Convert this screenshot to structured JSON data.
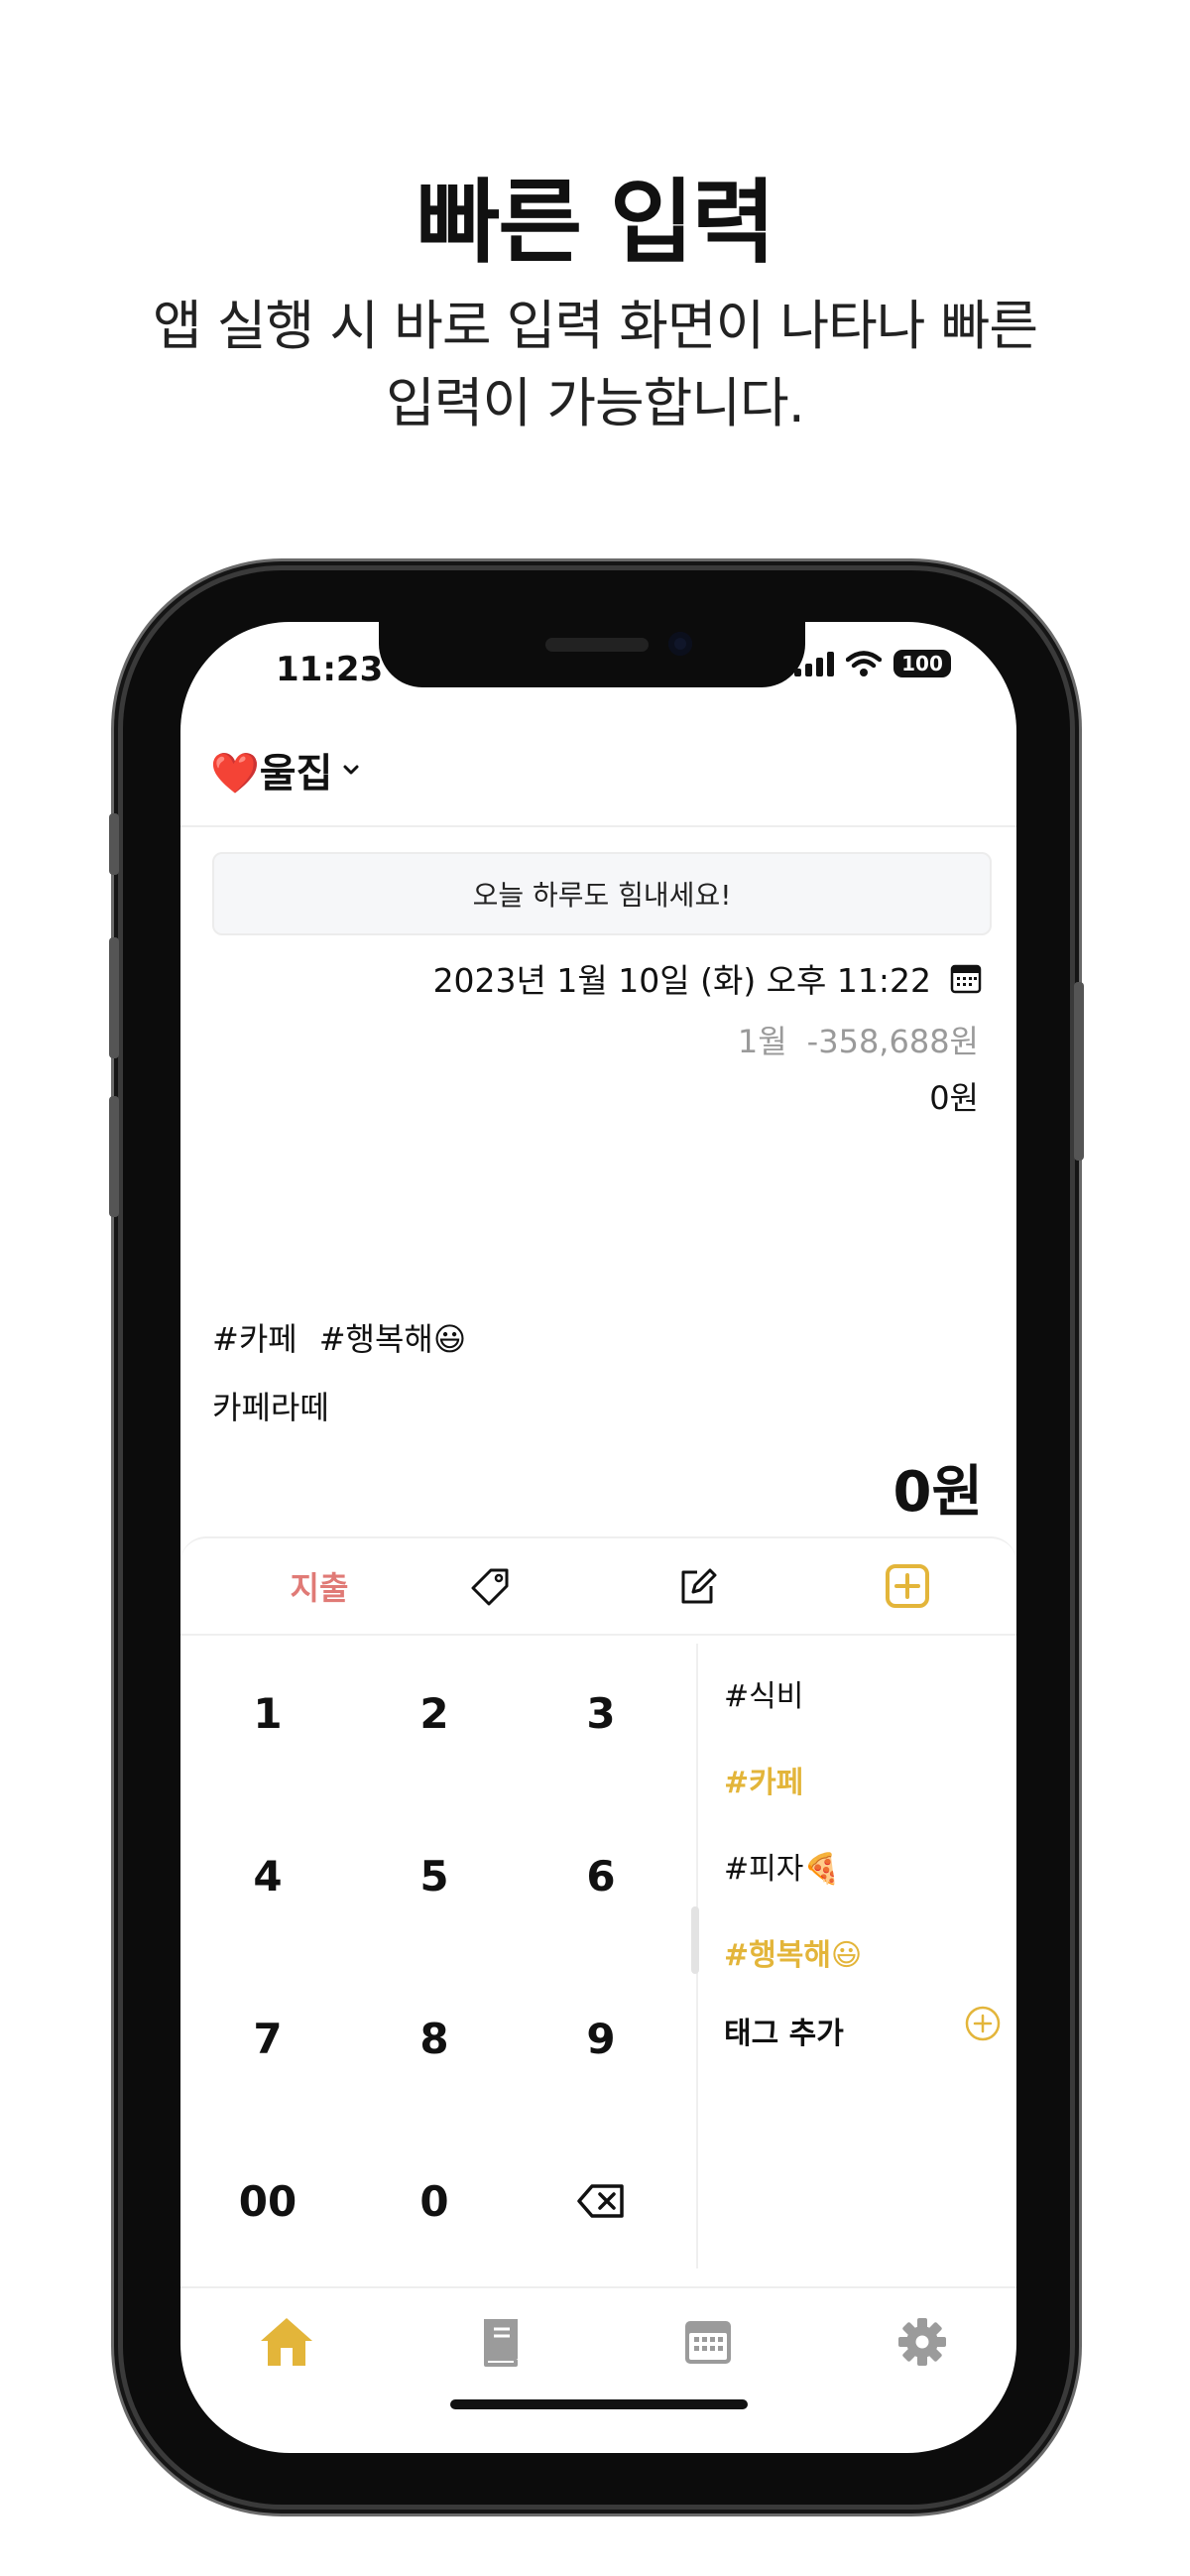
{
  "promo": {
    "title": "빠른 입력",
    "subtitle": "앱 실행 시 바로 입력 화면이 나타나 빠른 입력이 가능합니다."
  },
  "status_bar": {
    "time": "11:23",
    "battery": "100"
  },
  "header": {
    "book_name": "❤️울집"
  },
  "banner": {
    "text": "오늘 하루도 힘내세요!"
  },
  "entry": {
    "datetime": "2023년 1월 10일 (화) 오후 11:22",
    "month_label": "1월",
    "month_total": "-358,688원",
    "day_total": "0원",
    "tags": [
      "#카페",
      "#행복해😃"
    ],
    "memo": "카페라떼",
    "amount": "0원"
  },
  "toolbar": {
    "type_label": "지출"
  },
  "keypad": {
    "keys": [
      "1",
      "2",
      "3",
      "4",
      "5",
      "6",
      "7",
      "8",
      "9",
      "00",
      "0"
    ]
  },
  "tag_panel": {
    "items": [
      {
        "label": "#식비",
        "selected": false
      },
      {
        "label": "#카페",
        "selected": true
      },
      {
        "label": "#피자🍕",
        "selected": false
      },
      {
        "label": "#행복해😃",
        "selected": true
      }
    ],
    "add_label": "태그 추가"
  },
  "colors": {
    "accent": "#e3b53a",
    "expense": "#e07a76",
    "inactive_icon": "#9b9b9b"
  },
  "icons": {
    "toolbar": [
      "tag-icon",
      "edit-icon",
      "plus-square-icon"
    ],
    "tabbar": [
      "home-icon",
      "book-icon",
      "calendar-icon",
      "gear-icon"
    ]
  }
}
